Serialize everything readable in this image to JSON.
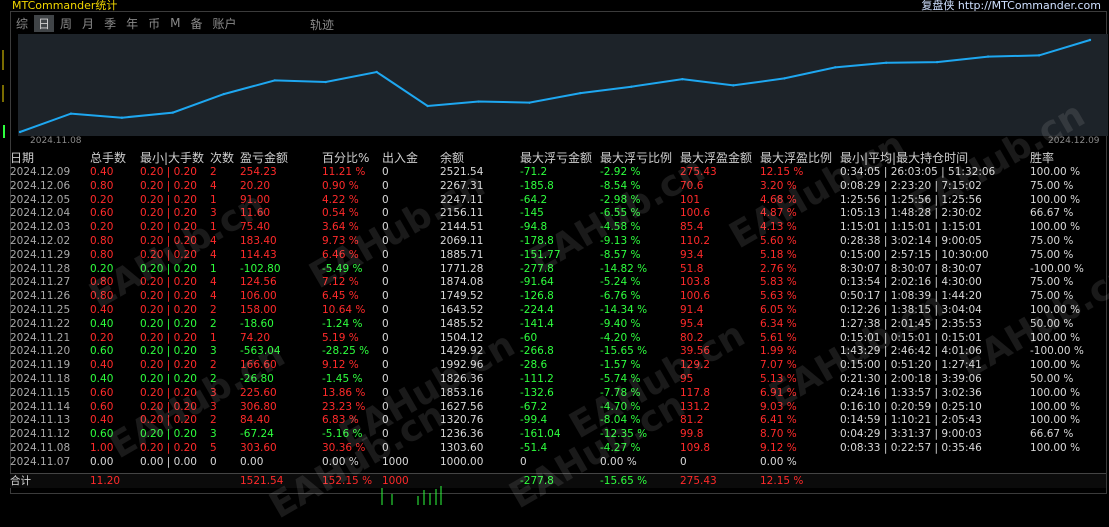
{
  "app": {
    "title": "MTCommander统计",
    "url": "复盘侠 http://MTCommander.com"
  },
  "tabs": [
    "综",
    "日",
    "周",
    "月",
    "季",
    "年",
    "币",
    "M",
    "备",
    "账户"
  ],
  "active_tab": 1,
  "track_label": "轨迹",
  "chart_start_date": "2024.11.08",
  "chart_end_date": "2024.12.09",
  "chart_data": {
    "type": "line",
    "x": [
      "2024.11.07",
      "2024.11.08",
      "2024.11.12",
      "2024.11.13",
      "2024.11.14",
      "2024.11.15",
      "2024.11.18",
      "2024.11.19",
      "2024.11.20",
      "2024.11.21",
      "2024.11.22",
      "2024.11.25",
      "2024.11.26",
      "2024.11.27",
      "2024.11.28",
      "2024.11.29",
      "2024.12.02",
      "2024.12.03",
      "2024.12.04",
      "2024.12.05",
      "2024.12.06",
      "2024.12.09"
    ],
    "values": [
      1000.0,
      1303.6,
      1236.36,
      1320.76,
      1627.56,
      1853.16,
      1826.36,
      1992.96,
      1429.92,
      1504.12,
      1485.52,
      1643.52,
      1749.52,
      1874.08,
      1771.28,
      1885.71,
      2069.11,
      2144.51,
      2156.11,
      2247.11,
      2267.31,
      2521.54
    ],
    "line_color": "#1ea7f0"
  },
  "columns": [
    "日期",
    "总手数",
    "最小|大手数",
    "次数",
    "盈亏金额",
    "百分比%",
    "出入金",
    "余额",
    "最大浮亏金额",
    "最大浮亏比例",
    "最大浮盈金额",
    "最大浮盈比例",
    "最小|平均|最大持仓时间",
    "胜率"
  ],
  "rows": [
    {
      "date": "2024.12.09",
      "lots": "0.40",
      "minmax": "0.20 | 0.20",
      "count": "2",
      "pnl": "254.23",
      "pct": "11.21 %",
      "io": "0",
      "balance": "2521.54",
      "mfl": "-71.2",
      "mflp": "-2.92 %",
      "mfp": "275.43",
      "mfpp": "12.15 %",
      "hold": "0:34:05 | 26:03:05 | 51:32:06",
      "win": "100.00 %",
      "c": "red"
    },
    {
      "date": "2024.12.06",
      "lots": "0.80",
      "minmax": "0.20 | 0.20",
      "count": "4",
      "pnl": "20.20",
      "pct": "0.90 %",
      "io": "0",
      "balance": "2267.31",
      "mfl": "-185.8",
      "mflp": "-8.54 %",
      "mfp": "70.6",
      "mfpp": "3.20 %",
      "hold": "0:08:29 | 2:23:20 | 7:15:02",
      "win": "75.00 %",
      "c": "red"
    },
    {
      "date": "2024.12.05",
      "lots": "0.20",
      "minmax": "0.20 | 0.20",
      "count": "1",
      "pnl": "91.00",
      "pct": "4.22 %",
      "io": "0",
      "balance": "2247.11",
      "mfl": "-64.2",
      "mflp": "-2.98 %",
      "mfp": "101",
      "mfpp": "4.68 %",
      "hold": "1:25:56 | 1:25:56 | 1:25:56",
      "win": "100.00 %",
      "c": "red"
    },
    {
      "date": "2024.12.04",
      "lots": "0.60",
      "minmax": "0.20 | 0.20",
      "count": "3",
      "pnl": "11.60",
      "pct": "0.54 %",
      "io": "0",
      "balance": "2156.11",
      "mfl": "-145",
      "mflp": "-6.55 %",
      "mfp": "100.6",
      "mfpp": "4.87 %",
      "hold": "1:05:13 | 1:48:28 | 2:30:02",
      "win": "66.67 %",
      "c": "red"
    },
    {
      "date": "2024.12.03",
      "lots": "0.20",
      "minmax": "0.20 | 0.20",
      "count": "1",
      "pnl": "75.40",
      "pct": "3.64 %",
      "io": "0",
      "balance": "2144.51",
      "mfl": "-94.8",
      "mflp": "-4.58 %",
      "mfp": "85.4",
      "mfpp": "4.13 %",
      "hold": "1:15:01 | 1:15:01 | 1:15:01",
      "win": "100.00 %",
      "c": "red"
    },
    {
      "date": "2024.12.02",
      "lots": "0.80",
      "minmax": "0.20 | 0.20",
      "count": "4",
      "pnl": "183.40",
      "pct": "9.73 %",
      "io": "0",
      "balance": "2069.11",
      "mfl": "-178.8",
      "mflp": "-9.13 %",
      "mfp": "110.2",
      "mfpp": "5.60 %",
      "hold": "0:28:38 | 3:02:14 | 9:00:05",
      "win": "75.00 %",
      "c": "red"
    },
    {
      "date": "2024.11.29",
      "lots": "0.80",
      "minmax": "0.20 | 0.20",
      "count": "4",
      "pnl": "114.43",
      "pct": "6.46 %",
      "io": "0",
      "balance": "1885.71",
      "mfl": "-151.77",
      "mflp": "-8.57 %",
      "mfp": "93.4",
      "mfpp": "5.18 %",
      "hold": "0:15:00 | 2:57:15 | 10:30:00",
      "win": "75.00 %",
      "c": "red"
    },
    {
      "date": "2024.11.28",
      "lots": "0.20",
      "minmax": "0.20 | 0.20",
      "count": "1",
      "pnl": "-102.80",
      "pct": "-5.49 %",
      "io": "0",
      "balance": "1771.28",
      "mfl": "-277.8",
      "mflp": "-14.82 %",
      "mfp": "51.8",
      "mfpp": "2.76 %",
      "hold": "8:30:07 | 8:30:07 | 8:30:07",
      "win": "-100.00 %",
      "c": "green"
    },
    {
      "date": "2024.11.27",
      "lots": "0.80",
      "minmax": "0.20 | 0.20",
      "count": "4",
      "pnl": "124.56",
      "pct": "7.12 %",
      "io": "0",
      "balance": "1874.08",
      "mfl": "-91.64",
      "mflp": "-5.24 %",
      "mfp": "103.8",
      "mfpp": "5.83 %",
      "hold": "0:13:54 | 2:02:16 | 4:30:00",
      "win": "75.00 %",
      "c": "red"
    },
    {
      "date": "2024.11.26",
      "lots": "0.80",
      "minmax": "0.20 | 0.20",
      "count": "4",
      "pnl": "106.00",
      "pct": "6.45 %",
      "io": "0",
      "balance": "1749.52",
      "mfl": "-126.8",
      "mflp": "-6.76 %",
      "mfp": "100.6",
      "mfpp": "5.63 %",
      "hold": "0:50:17 | 1:08:39 | 1:44:20",
      "win": "75.00 %",
      "c": "red"
    },
    {
      "date": "2024.11.25",
      "lots": "0.40",
      "minmax": "0.20 | 0.20",
      "count": "2",
      "pnl": "158.00",
      "pct": "10.64 %",
      "io": "0",
      "balance": "1643.52",
      "mfl": "-224.4",
      "mflp": "-14.34 %",
      "mfp": "91.4",
      "mfpp": "6.05 %",
      "hold": "0:12:26 | 1:38:15 | 3:04:04",
      "win": "100.00 %",
      "c": "red"
    },
    {
      "date": "2024.11.22",
      "lots": "0.40",
      "minmax": "0.20 | 0.20",
      "count": "2",
      "pnl": "-18.60",
      "pct": "-1.24 %",
      "io": "0",
      "balance": "1485.52",
      "mfl": "-141.4",
      "mflp": "-9.40 %",
      "mfp": "95.4",
      "mfpp": "6.34 %",
      "hold": "1:27:38 | 2:01:45 | 2:35:53",
      "win": "50.00 %",
      "c": "green"
    },
    {
      "date": "2024.11.21",
      "lots": "0.20",
      "minmax": "0.20 | 0.20",
      "count": "1",
      "pnl": "74.20",
      "pct": "5.19 %",
      "io": "0",
      "balance": "1504.12",
      "mfl": "-60",
      "mflp": "-4.20 %",
      "mfp": "80.2",
      "mfpp": "5.61 %",
      "hold": "0:15:01 | 0:15:01 | 0:15:01",
      "win": "100.00 %",
      "c": "red"
    },
    {
      "date": "2024.11.20",
      "lots": "0.60",
      "minmax": "0.20 | 0.20",
      "count": "3",
      "pnl": "-563.04",
      "pct": "-28.25 %",
      "io": "0",
      "balance": "1429.92",
      "mfl": "-266.8",
      "mflp": "-15.65 %",
      "mfp": "39.56",
      "mfpp": "1.99 %",
      "hold": "1:43:29 | 2:46:42 | 4:01:06",
      "win": "-100.00 %",
      "c": "green"
    },
    {
      "date": "2024.11.19",
      "lots": "0.40",
      "minmax": "0.20 | 0.20",
      "count": "2",
      "pnl": "166.60",
      "pct": "9.12 %",
      "io": "0",
      "balance": "1992.96",
      "mfl": "-28.6",
      "mflp": "-1.57 %",
      "mfp": "129.2",
      "mfpp": "7.07 %",
      "hold": "0:15:00 | 0:51:20 | 1:27:41",
      "win": "100.00 %",
      "c": "red"
    },
    {
      "date": "2024.11.18",
      "lots": "0.40",
      "minmax": "0.20 | 0.20",
      "count": "2",
      "pnl": "-26.80",
      "pct": "-1.45 %",
      "io": "0",
      "balance": "1826.36",
      "mfl": "-111.2",
      "mflp": "-5.74 %",
      "mfp": "95",
      "mfpp": "5.13 %",
      "hold": "0:21:30 | 2:00:18 | 3:39:06",
      "win": "50.00 %",
      "c": "green"
    },
    {
      "date": "2024.11.15",
      "lots": "0.60",
      "minmax": "0.20 | 0.20",
      "count": "3",
      "pnl": "225.60",
      "pct": "13.86 %",
      "io": "0",
      "balance": "1853.16",
      "mfl": "-132.6",
      "mflp": "-7.78 %",
      "mfp": "117.8",
      "mfpp": "6.91 %",
      "hold": "0:24:16 | 1:33:57 | 3:02:36",
      "win": "100.00 %",
      "c": "red"
    },
    {
      "date": "2024.11.14",
      "lots": "0.60",
      "minmax": "0.20 | 0.20",
      "count": "3",
      "pnl": "306.80",
      "pct": "23.23 %",
      "io": "0",
      "balance": "1627.56",
      "mfl": "-67.2",
      "mflp": "-4.70 %",
      "mfp": "131.2",
      "mfpp": "9.03 %",
      "hold": "0:16:10 | 0:20:59 | 0:25:10",
      "win": "100.00 %",
      "c": "red"
    },
    {
      "date": "2024.11.13",
      "lots": "0.40",
      "minmax": "0.20 | 0.20",
      "count": "2",
      "pnl": "84.40",
      "pct": "6.83 %",
      "io": "0",
      "balance": "1320.76",
      "mfl": "-99.4",
      "mflp": "-8.04 %",
      "mfp": "81.2",
      "mfpp": "6.41 %",
      "hold": "0:14:59 | 1:10:21 | 2:05:43",
      "win": "100.00 %",
      "c": "red"
    },
    {
      "date": "2024.11.12",
      "lots": "0.60",
      "minmax": "0.20 | 0.20",
      "count": "3",
      "pnl": "-67.24",
      "pct": "-5.16 %",
      "io": "0",
      "balance": "1236.36",
      "mfl": "-161.04",
      "mflp": "-12.35 %",
      "mfp": "99.8",
      "mfpp": "8.70 %",
      "hold": "0:04:29 | 3:31:37 | 9:00:03",
      "win": "66.67 %",
      "c": "green"
    },
    {
      "date": "2024.11.08",
      "lots": "1.00",
      "minmax": "0.20 | 0.20",
      "count": "5",
      "pnl": "303.60",
      "pct": "30.36 %",
      "io": "0",
      "balance": "1303.60",
      "mfl": "-51.4",
      "mflp": "-4.27 %",
      "mfp": "109.8",
      "mfpp": "9.12 %",
      "hold": "0:08:33 | 0:22:57 | 0:35:46",
      "win": "100.00 %",
      "c": "red"
    },
    {
      "date": "2024.11.07",
      "lots": "0.00",
      "minmax": "0.00 | 0.00",
      "count": "0",
      "pnl": "0.00",
      "pct": "0.00 %",
      "io": "1000",
      "balance": "1000.00",
      "mfl": "0",
      "mflp": "0.00 %",
      "mfp": "0",
      "mfpp": "0.00 %",
      "hold": "",
      "win": "",
      "c": "white"
    }
  ],
  "total": {
    "label": "合计",
    "lots": "11.20",
    "pnl": "1521.54",
    "pct": "152.15 %",
    "io": "1000",
    "mfl": "-277.8",
    "mflp": "-15.65 %",
    "mfp": "275.43",
    "mfpp": "12.15 %"
  },
  "watermark": "EAHub.cn",
  "colors": {
    "profit": "#ff2a2a",
    "loss": "#2eff3e",
    "accent": "#1ea7f0"
  }
}
